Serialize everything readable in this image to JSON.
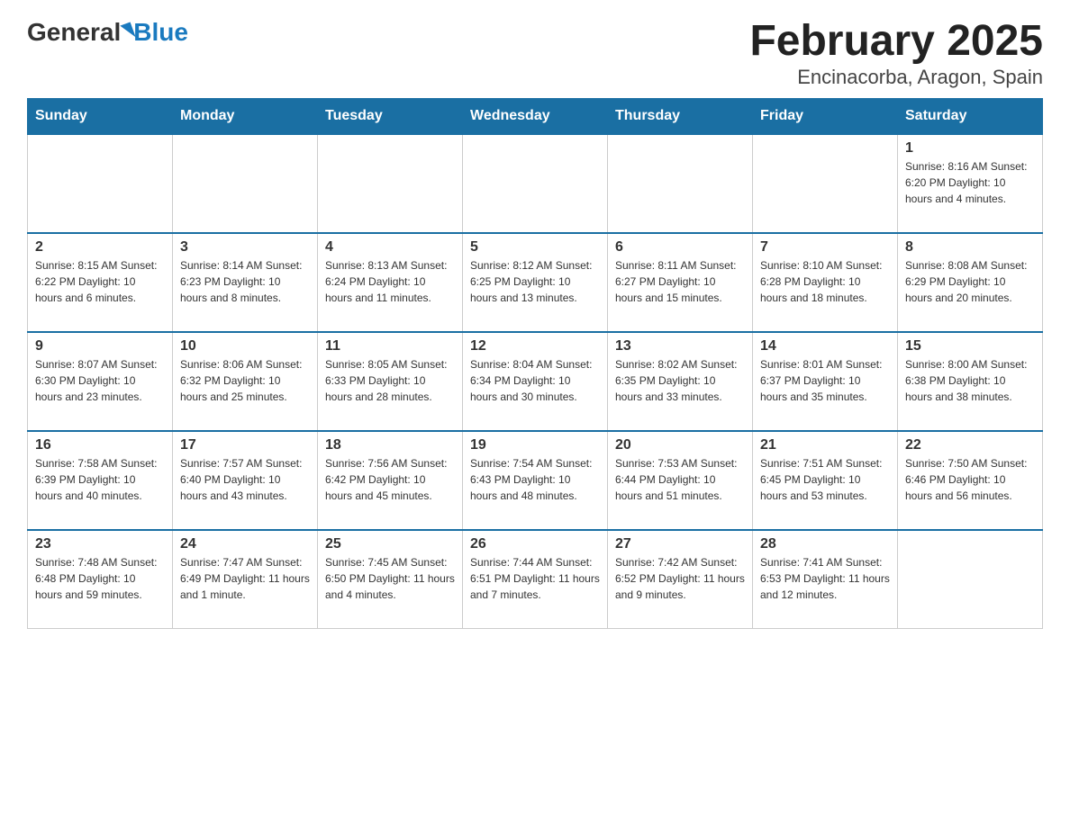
{
  "header": {
    "logo_general": "General",
    "logo_blue": "Blue",
    "title": "February 2025",
    "subtitle": "Encinacorba, Aragon, Spain"
  },
  "days_of_week": [
    "Sunday",
    "Monday",
    "Tuesday",
    "Wednesday",
    "Thursday",
    "Friday",
    "Saturday"
  ],
  "weeks": [
    [
      {
        "day": "",
        "info": ""
      },
      {
        "day": "",
        "info": ""
      },
      {
        "day": "",
        "info": ""
      },
      {
        "day": "",
        "info": ""
      },
      {
        "day": "",
        "info": ""
      },
      {
        "day": "",
        "info": ""
      },
      {
        "day": "1",
        "info": "Sunrise: 8:16 AM\nSunset: 6:20 PM\nDaylight: 10 hours and 4 minutes."
      }
    ],
    [
      {
        "day": "2",
        "info": "Sunrise: 8:15 AM\nSunset: 6:22 PM\nDaylight: 10 hours and 6 minutes."
      },
      {
        "day": "3",
        "info": "Sunrise: 8:14 AM\nSunset: 6:23 PM\nDaylight: 10 hours and 8 minutes."
      },
      {
        "day": "4",
        "info": "Sunrise: 8:13 AM\nSunset: 6:24 PM\nDaylight: 10 hours and 11 minutes."
      },
      {
        "day": "5",
        "info": "Sunrise: 8:12 AM\nSunset: 6:25 PM\nDaylight: 10 hours and 13 minutes."
      },
      {
        "day": "6",
        "info": "Sunrise: 8:11 AM\nSunset: 6:27 PM\nDaylight: 10 hours and 15 minutes."
      },
      {
        "day": "7",
        "info": "Sunrise: 8:10 AM\nSunset: 6:28 PM\nDaylight: 10 hours and 18 minutes."
      },
      {
        "day": "8",
        "info": "Sunrise: 8:08 AM\nSunset: 6:29 PM\nDaylight: 10 hours and 20 minutes."
      }
    ],
    [
      {
        "day": "9",
        "info": "Sunrise: 8:07 AM\nSunset: 6:30 PM\nDaylight: 10 hours and 23 minutes."
      },
      {
        "day": "10",
        "info": "Sunrise: 8:06 AM\nSunset: 6:32 PM\nDaylight: 10 hours and 25 minutes."
      },
      {
        "day": "11",
        "info": "Sunrise: 8:05 AM\nSunset: 6:33 PM\nDaylight: 10 hours and 28 minutes."
      },
      {
        "day": "12",
        "info": "Sunrise: 8:04 AM\nSunset: 6:34 PM\nDaylight: 10 hours and 30 minutes."
      },
      {
        "day": "13",
        "info": "Sunrise: 8:02 AM\nSunset: 6:35 PM\nDaylight: 10 hours and 33 minutes."
      },
      {
        "day": "14",
        "info": "Sunrise: 8:01 AM\nSunset: 6:37 PM\nDaylight: 10 hours and 35 minutes."
      },
      {
        "day": "15",
        "info": "Sunrise: 8:00 AM\nSunset: 6:38 PM\nDaylight: 10 hours and 38 minutes."
      }
    ],
    [
      {
        "day": "16",
        "info": "Sunrise: 7:58 AM\nSunset: 6:39 PM\nDaylight: 10 hours and 40 minutes."
      },
      {
        "day": "17",
        "info": "Sunrise: 7:57 AM\nSunset: 6:40 PM\nDaylight: 10 hours and 43 minutes."
      },
      {
        "day": "18",
        "info": "Sunrise: 7:56 AM\nSunset: 6:42 PM\nDaylight: 10 hours and 45 minutes."
      },
      {
        "day": "19",
        "info": "Sunrise: 7:54 AM\nSunset: 6:43 PM\nDaylight: 10 hours and 48 minutes."
      },
      {
        "day": "20",
        "info": "Sunrise: 7:53 AM\nSunset: 6:44 PM\nDaylight: 10 hours and 51 minutes."
      },
      {
        "day": "21",
        "info": "Sunrise: 7:51 AM\nSunset: 6:45 PM\nDaylight: 10 hours and 53 minutes."
      },
      {
        "day": "22",
        "info": "Sunrise: 7:50 AM\nSunset: 6:46 PM\nDaylight: 10 hours and 56 minutes."
      }
    ],
    [
      {
        "day": "23",
        "info": "Sunrise: 7:48 AM\nSunset: 6:48 PM\nDaylight: 10 hours and 59 minutes."
      },
      {
        "day": "24",
        "info": "Sunrise: 7:47 AM\nSunset: 6:49 PM\nDaylight: 11 hours and 1 minute."
      },
      {
        "day": "25",
        "info": "Sunrise: 7:45 AM\nSunset: 6:50 PM\nDaylight: 11 hours and 4 minutes."
      },
      {
        "day": "26",
        "info": "Sunrise: 7:44 AM\nSunset: 6:51 PM\nDaylight: 11 hours and 7 minutes."
      },
      {
        "day": "27",
        "info": "Sunrise: 7:42 AM\nSunset: 6:52 PM\nDaylight: 11 hours and 9 minutes."
      },
      {
        "day": "28",
        "info": "Sunrise: 7:41 AM\nSunset: 6:53 PM\nDaylight: 11 hours and 12 minutes."
      },
      {
        "day": "",
        "info": ""
      }
    ]
  ]
}
